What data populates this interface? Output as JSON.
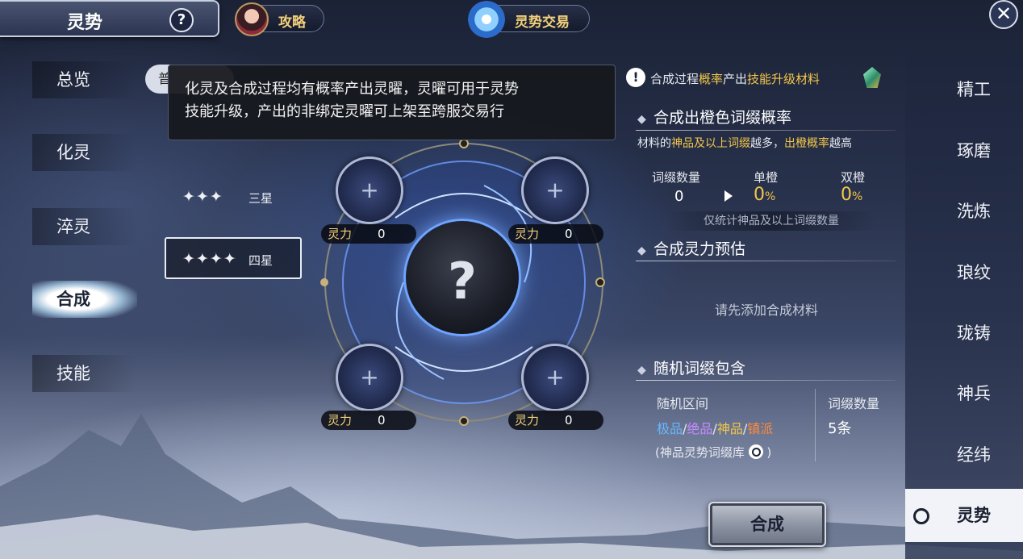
{
  "header": {
    "title": "灵势",
    "help_label": "?",
    "guide_label": "攻略",
    "trade_label": "灵势交易",
    "close_label": "✕"
  },
  "left_nav": {
    "items": [
      {
        "label": "总览",
        "active": false
      },
      {
        "label": "化灵",
        "active": false
      },
      {
        "label": "淬灵",
        "active": false
      },
      {
        "label": "合成",
        "active": true
      },
      {
        "label": "技能",
        "active": false
      }
    ]
  },
  "filters": {
    "pill_label": "普",
    "rows": [
      {
        "stars": "✦✦✦",
        "label": "三星",
        "selected": false
      },
      {
        "stars": "✦✦✦✦",
        "label": "四星",
        "selected": true
      }
    ]
  },
  "tooltip": {
    "line1": "化灵及合成过程均有概率产出灵曜，灵曜可用于灵势",
    "line2": "技能升级，产出的非绑定灵曜可上架至跨服交易行"
  },
  "slots": [
    {
      "plus": "+",
      "power_label": "灵力",
      "power_value": "0"
    },
    {
      "plus": "+",
      "power_label": "灵力",
      "power_value": "0"
    },
    {
      "plus": "+",
      "power_label": "灵力",
      "power_value": "0"
    },
    {
      "plus": "+",
      "power_label": "灵力",
      "power_value": "0"
    }
  ],
  "core_symbol": "?",
  "info": {
    "icon": "!",
    "note_a": "合成过程",
    "note_b": "概率",
    "note_c": "产出",
    "note_d": "技能升级材料",
    "section1_title": "合成出橙色词缀概率",
    "section1_desc_a": "材料的",
    "section1_desc_b": "神品及以上词缀",
    "section1_desc_c": "越多，",
    "section1_desc_d": "出橙概率",
    "section1_desc_e": "越高",
    "col_count": "词缀数量",
    "col_single": "单橙",
    "col_double": "双橙",
    "count_value": "0",
    "single_value": "0",
    "double_value": "0",
    "percent": "%",
    "count_note": "仅统计神品及以上词缀数量",
    "section2_title": "合成灵力预估",
    "add_hint": "请先添加合成材料",
    "section3_title": "随机词缀包含",
    "range_header": "随机区间",
    "count_header": "词缀数量",
    "range_1": "极品",
    "range_2": "绝品",
    "range_3": "神品",
    "range_4": "镇派",
    "sep": "/",
    "lib_open": "(神品灵势词缀库",
    "lib_close": ")",
    "count_text": "5条"
  },
  "synth_button": "合成",
  "right_nav": {
    "items": [
      {
        "label": "精工",
        "active": false
      },
      {
        "label": "琢磨",
        "active": false
      },
      {
        "label": "洗炼",
        "active": false
      },
      {
        "label": "琅纹",
        "active": false
      },
      {
        "label": "珑铸",
        "active": false
      },
      {
        "label": "神兵",
        "active": false
      },
      {
        "label": "经纬",
        "active": false
      },
      {
        "label": "灵势",
        "active": true
      }
    ]
  },
  "colors": {
    "accent_gold": "#f3c64a",
    "tier_blue": "#69b7ff",
    "tier_purple": "#c58bff",
    "tier_orange": "#ff8a3c"
  }
}
